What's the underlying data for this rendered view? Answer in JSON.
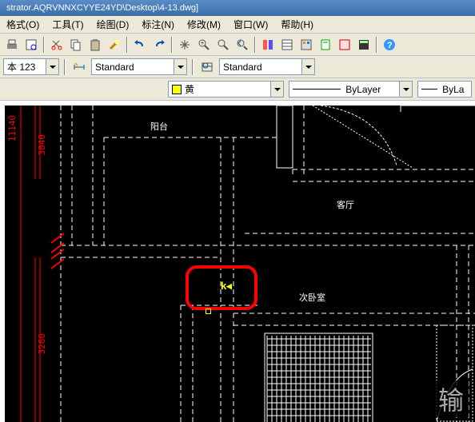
{
  "title": "strator.AQRVNNXCYYE24YD\\Desktop\\4-13.dwg]",
  "menu": {
    "format": "格式(O)",
    "tools": "工具(T)",
    "draw": "绘图(D)",
    "dimension": "标注(N)",
    "modify": "修改(M)",
    "window": "窗口(W)",
    "help": "帮助(H)"
  },
  "style": {
    "text_label": "本 123",
    "dim_style": "Standard",
    "table_style": "Standard"
  },
  "layer": {
    "color_name": "黄",
    "linetype": "ByLayer",
    "lineweight": "ByLa"
  },
  "dims": {
    "d1": "11140",
    "d2": "3840",
    "d3": "3260"
  },
  "rooms": {
    "balcony": "阳台",
    "living": "客厅",
    "bedroom": "次卧室"
  },
  "ime": "输"
}
